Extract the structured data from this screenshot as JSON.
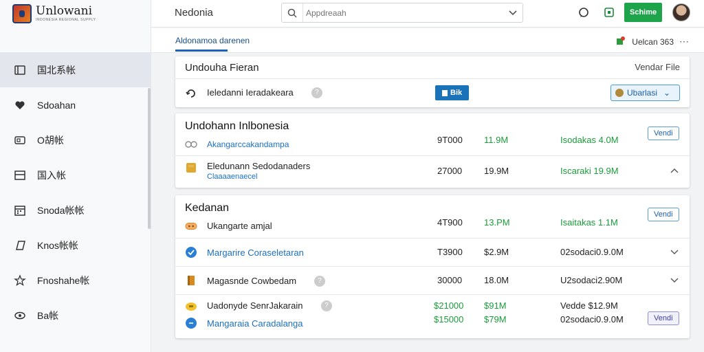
{
  "brand": {
    "name": "Unlowani",
    "sub": "INDONESIA REGIONAL SUPPLY",
    "logo": "crest-logo"
  },
  "sidebar": {
    "items": [
      {
        "label": "国北系帐",
        "icon": "folder-icon",
        "active": true
      },
      {
        "label": "Sdoahan",
        "icon": "heart-icon"
      },
      {
        "label": "O胡帐",
        "icon": "card-icon"
      },
      {
        "label": "国入帐",
        "icon": "inbox-icon"
      },
      {
        "label": "Snoda帐帐",
        "icon": "calendar-icon"
      },
      {
        "label": "Knos帐帐",
        "icon": "tag-icon"
      },
      {
        "label": "Fnoshahe帐",
        "icon": "star-icon"
      },
      {
        "label": "Ba帐",
        "icon": "eye-icon"
      }
    ]
  },
  "topbar": {
    "title": "Nedonia",
    "search_placeholder": "Appdreaah",
    "action_label": "Schime"
  },
  "subbar": {
    "tab": "Aldonamoa darenen",
    "right_label": "Uelcan 363"
  },
  "vendor_panel": {
    "title": "Undouha Fieran",
    "file_label": "Vendar File",
    "row_label": "Ieledanni Ieradakeara",
    "badge": "Bik",
    "select_label": "Ubarlasi"
  },
  "groups": [
    {
      "title": "Undohann Inlbonesia",
      "title_sub": "Akangarccakandampa",
      "pill": "Vendi",
      "rows": [
        {
          "head": true,
          "col1": "9T000",
          "col2": "11.9M",
          "col3": "Isodakas 4.0M"
        },
        {
          "label": "Eledunann Sedodanaders",
          "sub": "Claaaaenaecel",
          "col1": "27000",
          "col2": "19.9M",
          "col3": "Iscaraki 19.9M"
        }
      ]
    },
    {
      "title": "Kedanan",
      "title_sub": "Ukangarte amjal",
      "pill": "Vendi",
      "rows": [
        {
          "head": true,
          "col1": "4T900",
          "col2": "13.PM",
          "col3": "Isaitakas 1.1M"
        },
        {
          "label": "Margarire Coraseletaran",
          "col1": "T3900",
          "col2": "$2.9M",
          "col3": "02sodaci0.9.0M"
        },
        {
          "label": "Magasnde Cowbedam",
          "col1": "30000",
          "col2": "18.0M",
          "col3": "U2sodaci2.90M"
        },
        {
          "label": "Uadonyde SenrJakarain",
          "sub": "Mangaraia Caradalanga",
          "col1": "$21000",
          "col1b": "$15000",
          "col2": "$91M",
          "col2b": "$79M",
          "col3": "Vedde $12.9M",
          "col3b": "02sodaci0.9.0M",
          "pill": "Vendi"
        }
      ]
    }
  ],
  "colors": {
    "accent": "#1a63b8",
    "green": "#1ea54b"
  }
}
